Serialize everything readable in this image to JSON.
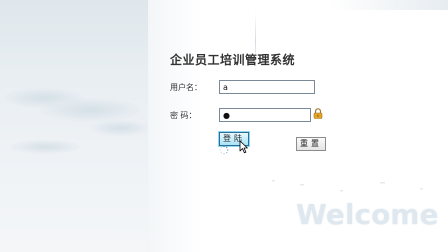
{
  "app": {
    "title": "企业员工培训管理系统"
  },
  "form": {
    "username_label": "用户名：",
    "username_value": "a",
    "password_label": "密 码：",
    "password_value": "●"
  },
  "buttons": {
    "login_label": "登陆",
    "reset_label": "重置"
  },
  "decor": {
    "welcome_text": "Welcome"
  },
  "colors": {
    "login_button": "#a9e3f7",
    "lock_icon": "#e0a52a",
    "title_text": "#333333"
  },
  "icons": [
    "lock-icon",
    "loading-spinner-icon",
    "mouse-cursor-icon"
  ]
}
